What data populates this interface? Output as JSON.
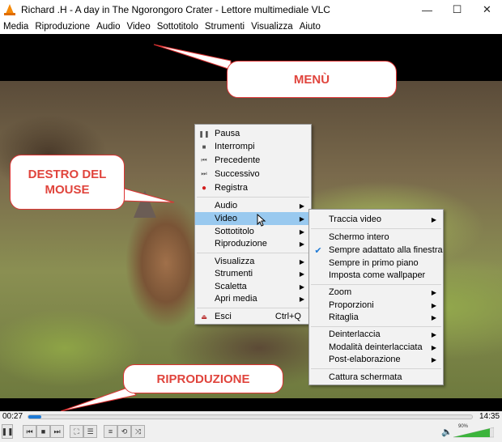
{
  "window": {
    "title": "Richard .H - A day in The Ngorongoro Crater - Lettore multimediale VLC",
    "controls": [
      "—",
      "☐",
      "✕"
    ]
  },
  "menubar": [
    "Media",
    "Riproduzione",
    "Audio",
    "Video",
    "Sottotitolo",
    "Strumenti",
    "Visualizza",
    "Aiuto"
  ],
  "callouts": {
    "menu": "MENÙ",
    "mouse": "DESTRO DEL MOUSE",
    "playback": "RIPRODUZIONE"
  },
  "context_menu": {
    "items": [
      {
        "label": "Pausa",
        "icon": "pause-icon"
      },
      {
        "label": "Interrompi",
        "icon": "stop-icon"
      },
      {
        "label": "Precedente",
        "icon": "previous-icon"
      },
      {
        "label": "Successivo",
        "icon": "next-icon"
      },
      {
        "label": "Registra",
        "icon": "record-icon"
      },
      {
        "label": "Audio",
        "submenu": true
      },
      {
        "label": "Video",
        "submenu": true,
        "highlighted": true
      },
      {
        "label": "Sottotitolo",
        "submenu": true
      },
      {
        "label": "Riproduzione",
        "submenu": true
      },
      {
        "label": "Visualizza",
        "submenu": true
      },
      {
        "label": "Strumenti",
        "submenu": true
      },
      {
        "label": "Scaletta",
        "submenu": true
      },
      {
        "label": "Apri media",
        "submenu": true
      },
      {
        "label": "Esci",
        "icon": "exit-icon",
        "shortcut": "Ctrl+Q"
      }
    ]
  },
  "video_submenu": {
    "items": [
      {
        "label": "Traccia video",
        "submenu": true
      },
      {
        "label": "Schermo intero"
      },
      {
        "label": "Sempre adattato alla finestra",
        "checked": true
      },
      {
        "label": "Sempre in primo piano"
      },
      {
        "label": "Imposta come wallpaper"
      },
      {
        "label": "Zoom",
        "submenu": true
      },
      {
        "label": "Proporzioni",
        "submenu": true
      },
      {
        "label": "Ritaglia",
        "submenu": true
      },
      {
        "label": "Deinterlaccia",
        "submenu": true
      },
      {
        "label": "Modalità deinterlacciata",
        "submenu": true
      },
      {
        "label": "Post-elaborazione",
        "submenu": true
      },
      {
        "label": "Cattura schermata"
      }
    ]
  },
  "player": {
    "elapsed": "00:27",
    "total": "14:35",
    "progress_fraction": 0.03,
    "volume": "90%",
    "volume_fraction": 0.9
  },
  "colors": {
    "accent": "#1d79d5",
    "callout_text": "#e0443c",
    "highlight": "#99c9ef",
    "volume_green": "#3cb43c"
  }
}
